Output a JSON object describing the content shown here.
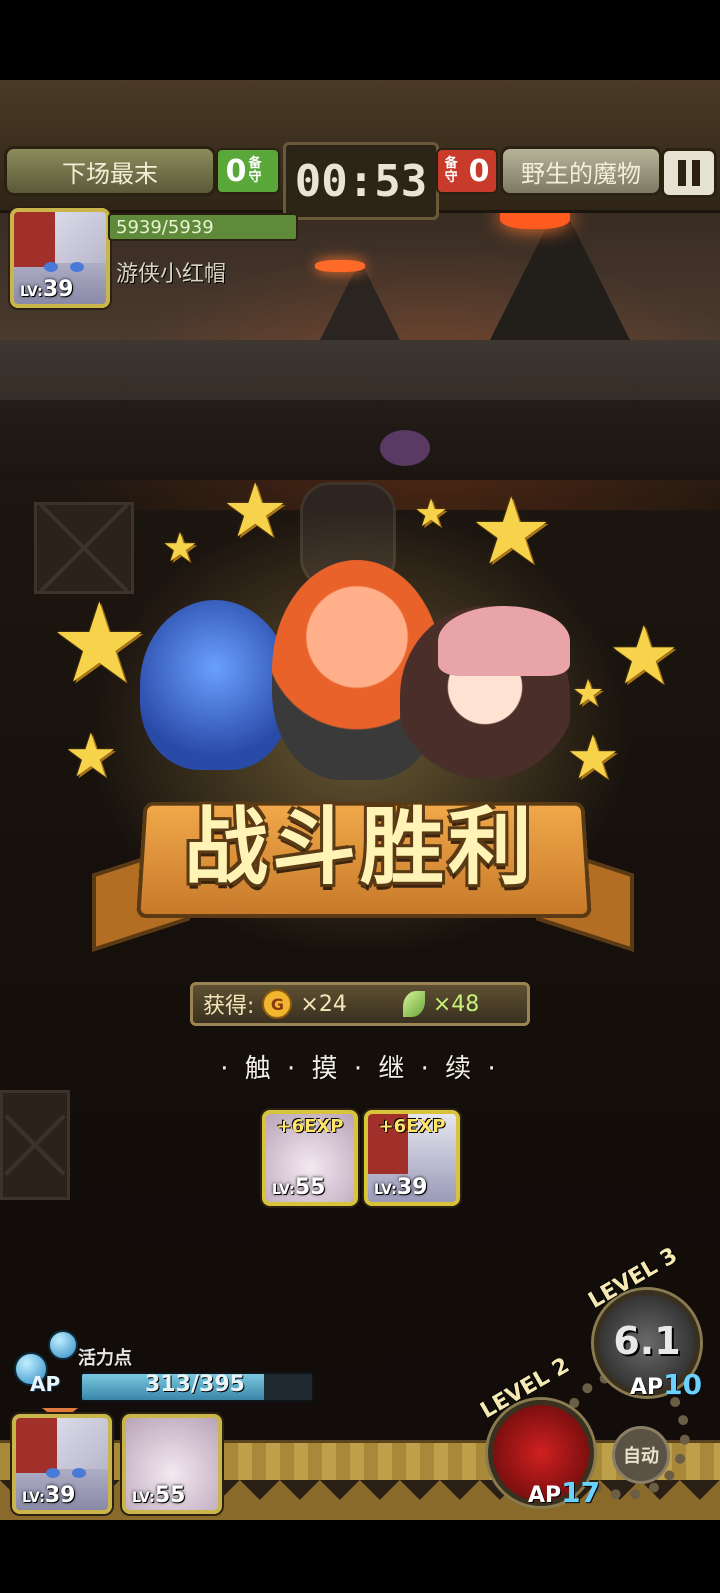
{
  "top_hud": {
    "left_team_name": "下场最末",
    "left_score": "0",
    "left_guard": "备守",
    "timer": "00:53",
    "right_guard": "备守",
    "right_score": "0",
    "right_team_name": "野生的魔物"
  },
  "hero": {
    "hp": "5939/5939",
    "hp_fraction": 1.0,
    "name": "游侠小红帽",
    "lv_prefix": "LV:",
    "level": "39"
  },
  "victory": {
    "title": "战斗胜利",
    "rewards_label": "获得:",
    "coin_symbol": "G",
    "coin_amount": "×24",
    "feather_amount": "×48",
    "touch_continue": "· 触 · 摸 · 继 · 续 ·",
    "exp_cards": [
      {
        "exp": "+6EXP",
        "lv_prefix": "LV:",
        "level": "55"
      },
      {
        "exp": "+6EXP",
        "lv_prefix": "LV:",
        "level": "39"
      }
    ]
  },
  "bottom_hud": {
    "ap_label": "活力点",
    "ap_icon": "AP",
    "ap_value": "313/395",
    "ap_fraction": 0.792,
    "party": [
      {
        "lv_prefix": "LV:",
        "level": "39"
      },
      {
        "lv_prefix": "LV:",
        "level": "55"
      }
    ],
    "skill_1": {
      "level_label": "LEVEL 3",
      "value": "6.1",
      "ap_label": "AP",
      "ap_cost": "10"
    },
    "skill_2": {
      "level_label": "LEVEL 2",
      "ap_label": "AP",
      "ap_cost": "17"
    },
    "auto_label": "自动"
  }
}
